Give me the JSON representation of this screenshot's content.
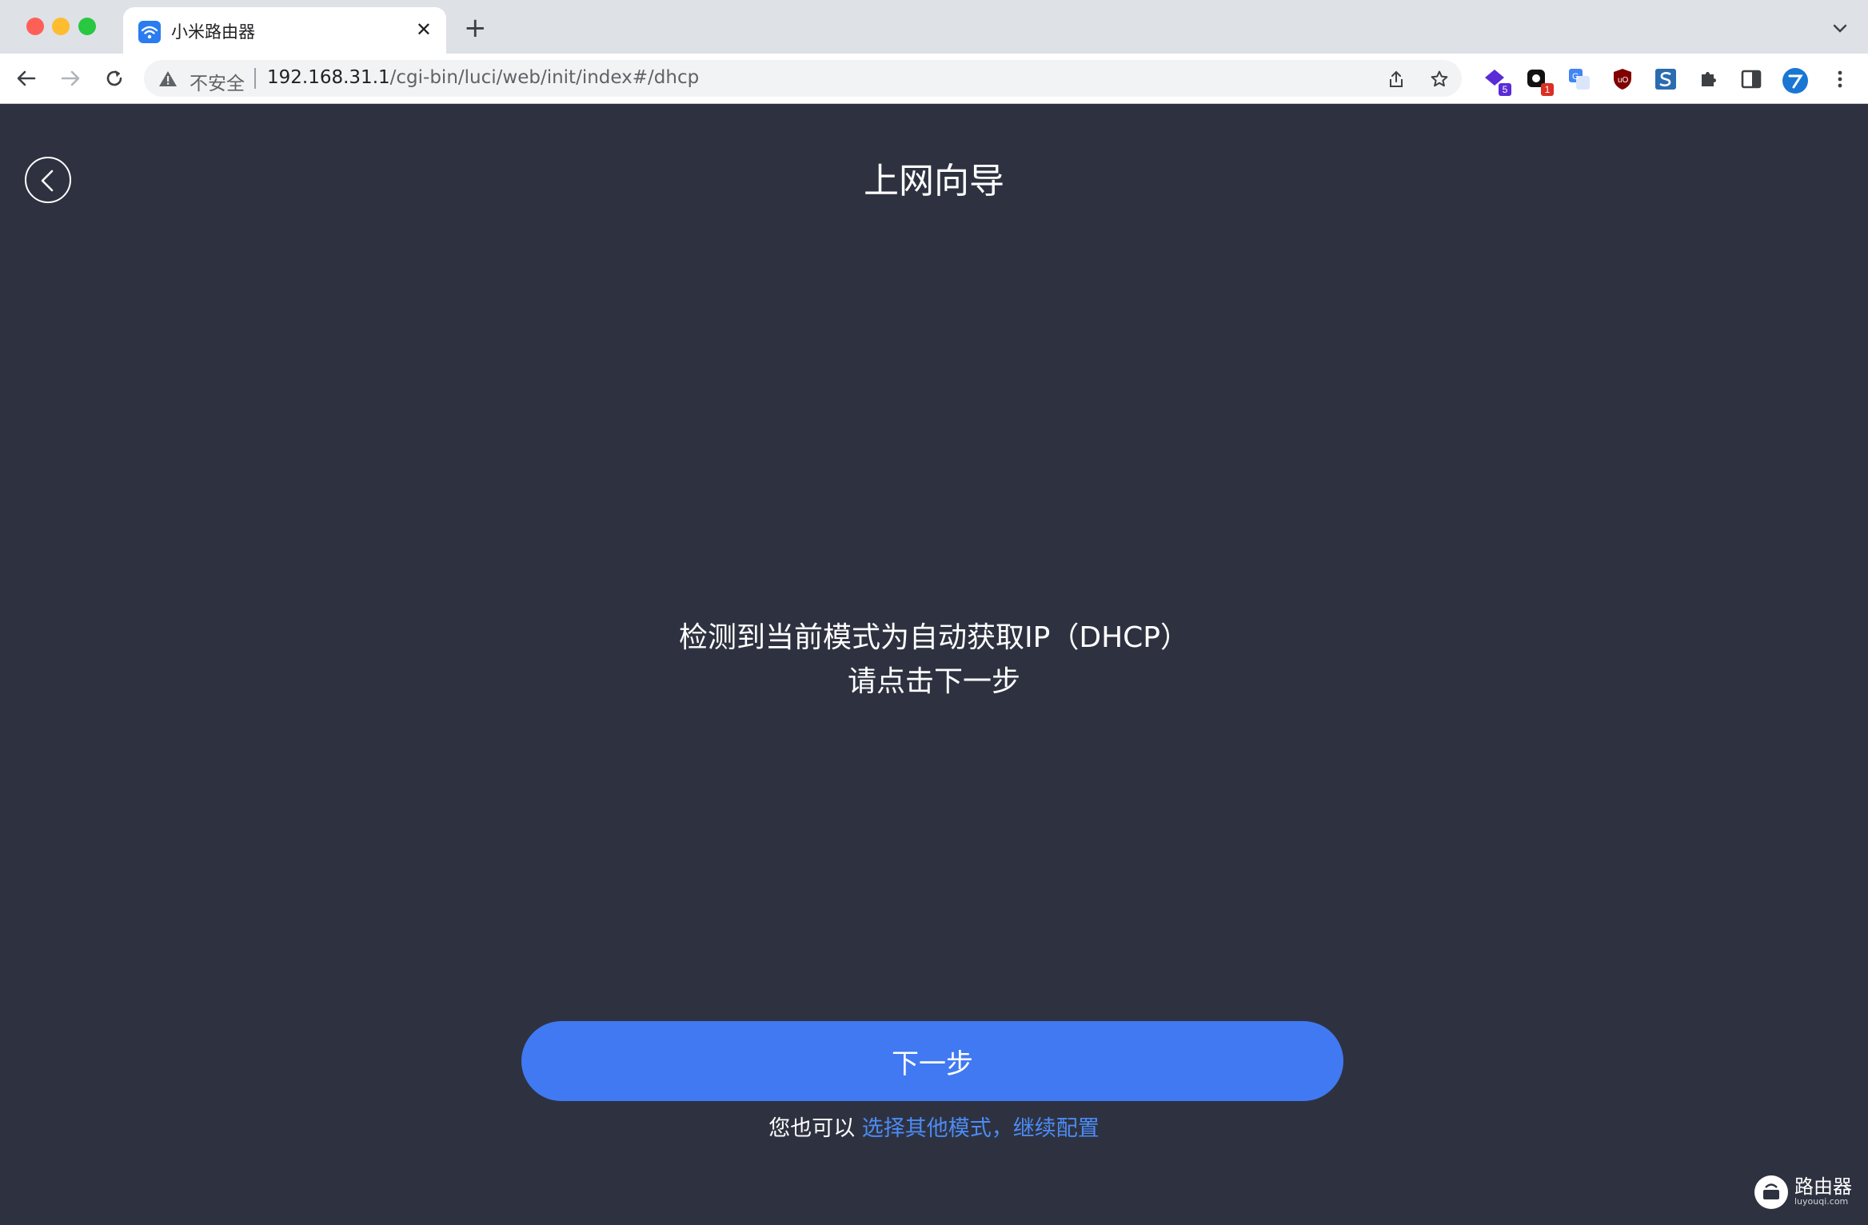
{
  "browser": {
    "tab_title": "小米路由器",
    "security_label": "不安全",
    "url_host": "192.168.31.1",
    "url_path": "/cgi-bin/luci/web/init/index#/dhcp",
    "extensions": [
      {
        "name": "ext-1",
        "badge": "5",
        "color": "#5b2bd6",
        "badge_color": "#5b2bd6"
      },
      {
        "name": "ext-2",
        "badge": "1",
        "color": "#111111",
        "badge_color": "#d93025"
      }
    ]
  },
  "page": {
    "title": "上网向导",
    "message_line1": "检测到当前模式为自动获取IP（DHCP）",
    "message_line2": "请点击下一步",
    "next_button": "下一步",
    "hint_prefix": "您也可以 ",
    "hint_link": "选择其他模式，继续配置",
    "background_color": "#2e3240",
    "accent_color": "#4179f2"
  },
  "watermark": {
    "text": "路由器",
    "sub": "luyouqi.com"
  }
}
